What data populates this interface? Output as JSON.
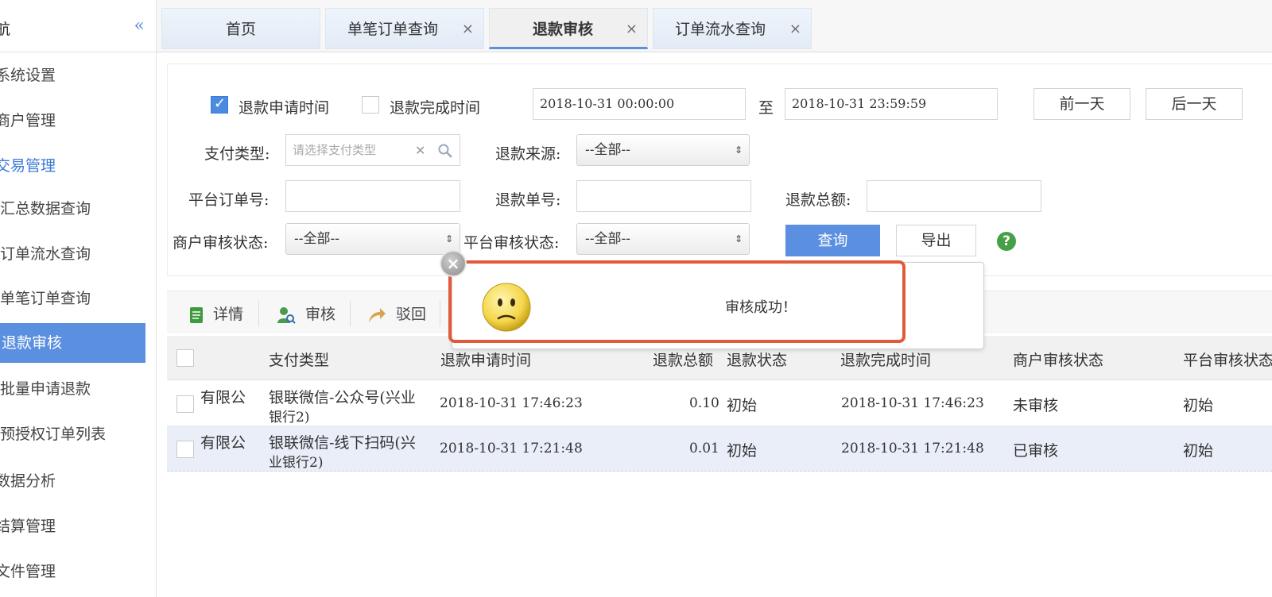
{
  "sidebar": {
    "title": "航",
    "collapse_icon": "«",
    "items": [
      {
        "label": "系统设置"
      },
      {
        "label": "商户管理"
      },
      {
        "label": "交易管理"
      },
      {
        "label": "汇总数据查询"
      },
      {
        "label": "订单流水查询"
      },
      {
        "label": "单笔订单查询"
      },
      {
        "label": "退款审核"
      },
      {
        "label": "批量申请退款"
      },
      {
        "label": "预授权订单列表"
      },
      {
        "label": "数据分析"
      },
      {
        "label": "结算管理"
      },
      {
        "label": "文件管理"
      }
    ]
  },
  "tabs": [
    {
      "label": "首页"
    },
    {
      "label": "单笔订单查询",
      "close": "×"
    },
    {
      "label": "退款审核",
      "close": "×"
    },
    {
      "label": "订单流水查询",
      "close": "×"
    }
  ],
  "filters": {
    "apply_time_label": "退款申请时间",
    "complete_time_label": "退款完成时间",
    "start_time": "2018-10-31  00:00:00",
    "to_label": "至",
    "end_time": "2018-10-31  23:59:59",
    "prev_day": "前一天",
    "next_day": "后一天",
    "pay_type_label": "支付类型:",
    "pay_type_placeholder": "请选择支付类型",
    "refund_source_label": "退款来源:",
    "refund_source_value": "--全部--",
    "platform_order_label": "平台订单号:",
    "refund_no_label": "退款单号:",
    "refund_total_label": "退款总额:",
    "merchant_audit_label": "商户审核状态:",
    "merchant_audit_value": "--全部--",
    "platform_audit_label": "平台审核状态:",
    "platform_audit_value": "--全部--",
    "query_button": "查询",
    "export_button": "导出",
    "help": "?"
  },
  "toolbar": {
    "detail": "详情",
    "audit": "审核",
    "reject": "驳回"
  },
  "table": {
    "headers": [
      "支付类型",
      "退款申请时间",
      "退款总额",
      "退款状态",
      "退款完成时间",
      "商户审核状态",
      "平台审核状态"
    ],
    "rows": [
      {
        "merchant": "有限公",
        "pay_type_1": "银联微信-公众号(兴业",
        "pay_type_2": "银行2)",
        "apply_time": "2018-10-31 17:46:23",
        "amount": "0.10",
        "status": "初始",
        "complete_time": "2018-10-31 17:46:23",
        "merchant_audit": "未审核",
        "platform_audit": "初始"
      },
      {
        "merchant": "有限公",
        "pay_type_1": "银联微信-线下扫码(兴",
        "pay_type_2": "业银行2)",
        "apply_time": "2018-10-31 17:21:48",
        "amount": "0.01",
        "status": "初始",
        "complete_time": "2018-10-31 17:21:48",
        "merchant_audit": "已审核",
        "platform_audit": "初始"
      }
    ]
  },
  "dialog": {
    "message": "审核成功！",
    "close": "×"
  },
  "colors": {
    "accent": "#5b8fe0",
    "highlight": "#e25a3c"
  }
}
